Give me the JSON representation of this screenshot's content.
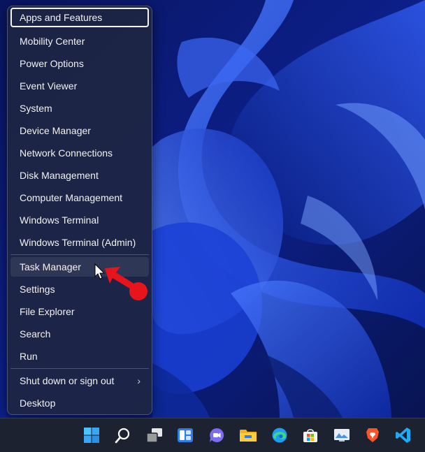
{
  "menu": {
    "items": [
      {
        "label": "Apps and Features"
      },
      {
        "label": "Mobility Center"
      },
      {
        "label": "Power Options"
      },
      {
        "label": "Event Viewer"
      },
      {
        "label": "System"
      },
      {
        "label": "Device Manager"
      },
      {
        "label": "Network Connections"
      },
      {
        "label": "Disk Management"
      },
      {
        "label": "Computer Management"
      },
      {
        "label": "Windows Terminal"
      },
      {
        "label": "Windows Terminal (Admin)"
      },
      {
        "label": "Task Manager"
      },
      {
        "label": "Settings"
      },
      {
        "label": "File Explorer"
      },
      {
        "label": "Search"
      },
      {
        "label": "Run"
      },
      {
        "label": "Shut down or sign out"
      },
      {
        "label": "Desktop"
      }
    ],
    "submenu_indicator": "›",
    "focused_item": "Apps and Features",
    "hovered_item": "Task Manager"
  },
  "taskbar": {
    "icons": [
      "windows-start-icon",
      "search-icon",
      "task-view-icon",
      "widgets-icon",
      "chat-icon",
      "file-explorer-icon",
      "edge-icon",
      "store-icon",
      "photos-icon",
      "brave-icon",
      "vscode-icon"
    ]
  },
  "colors": {
    "menu_bg": "#1e2642",
    "wallpaper_base": "#0a1a6e",
    "wallpaper_accent": "#3b63f0",
    "annotation_red": "#e8141c",
    "taskbar_bg": "#1d2230"
  }
}
